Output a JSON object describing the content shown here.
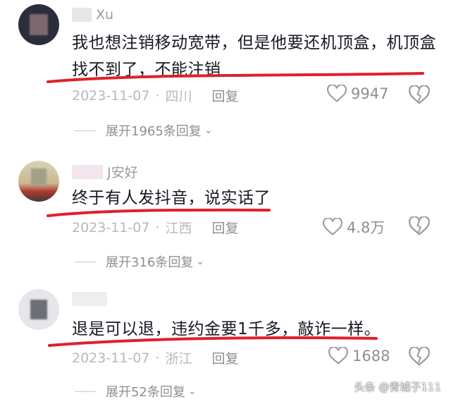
{
  "comments": [
    {
      "username": "Xu",
      "text": "我也想注销移动宽带，但是他要还机顶盒，机顶盒找不到了，不能注销",
      "date": "2023-11-07",
      "location": "四川",
      "reply_label": "回复",
      "likes": "9947",
      "expand_label": "展开1965条回复"
    },
    {
      "username": "J安好",
      "text": "终于有人发抖音，说实话了",
      "date": "2023-11-07",
      "location": "江西",
      "reply_label": "回复",
      "likes": "4.8万",
      "expand_label": "展开316条回复"
    },
    {
      "username": "",
      "text": "退是可以退，违约金要1千多，敲诈一样。",
      "date": "2023-11-07",
      "location": "浙江",
      "reply_label": "回复",
      "likes": "1688",
      "expand_label": "展开52条回复"
    }
  ],
  "meta_separator": "·",
  "watermark": "头条 @青城子111",
  "colors": {
    "underline": "#e0202a",
    "meta_text": "#b8b8bd",
    "body_text": "#161823"
  }
}
